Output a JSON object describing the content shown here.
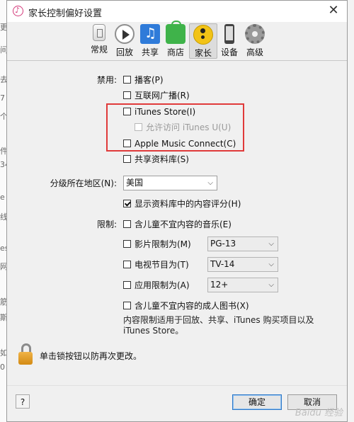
{
  "window": {
    "title": "家长控制偏好设置",
    "close_glyph": "✕"
  },
  "background_left_fragments": [
    "更",
    "间",
    "去",
    "7",
    "个",
    "件",
    "34",
    "e",
    "线",
    "es",
    "网",
    "筋",
    "斯",
    "如",
    "0"
  ],
  "toolbar": {
    "tabs": [
      {
        "label": "常规",
        "icon": "general-icon"
      },
      {
        "label": "回放",
        "icon": "playback-icon"
      },
      {
        "label": "共享",
        "icon": "sharing-icon"
      },
      {
        "label": "商店",
        "icon": "store-icon"
      },
      {
        "label": "家长",
        "icon": "parental-icon",
        "active": true
      },
      {
        "label": "设备",
        "icon": "devices-icon"
      },
      {
        "label": "高级",
        "icon": "advanced-icon"
      }
    ]
  },
  "disable": {
    "label": "禁用:",
    "items": [
      {
        "label": "播客(P)",
        "checked": false
      },
      {
        "label": "互联网广播(R)",
        "checked": false
      },
      {
        "label": "iTunes Store(I)",
        "checked": false
      },
      {
        "label": "允许访问 iTunes U(U)",
        "checked": false,
        "disabled": true
      },
      {
        "label": "Apple Music Connect(C)",
        "checked": false
      },
      {
        "label": "共享资料库(S)",
        "checked": false
      }
    ]
  },
  "region": {
    "label": "分级所在地区(N):",
    "value": "美国",
    "show_ratings_label": "显示资料库中的内容评分(H)",
    "show_ratings_checked": true
  },
  "restrict": {
    "label": "限制:",
    "explicit_music": {
      "label": "含儿童不宜内容的音乐(E)",
      "checked": false
    },
    "movies": {
      "label": "影片限制为(M)",
      "checked": false,
      "value": "PG-13"
    },
    "tv": {
      "label": "电视节目为(T)",
      "checked": false,
      "value": "TV-14"
    },
    "apps": {
      "label": "应用限制为(A)",
      "checked": false,
      "value": "12+"
    },
    "explicit_books": {
      "label": "含儿童不宜内容的成人图书(X)",
      "checked": false
    },
    "note_line1": "内容限制适用于回放、共享、iTunes 购买项目以及",
    "note_line2": "iTunes Store。"
  },
  "lock": {
    "text": "单击锁按钮以防再次更改。"
  },
  "footer": {
    "help_label": "?",
    "ok_label": "确定",
    "cancel_label": "取消",
    "watermark": "Baidu 经验"
  },
  "colors": {
    "highlight": "#e03a3a",
    "primary_border": "#2f79c8"
  }
}
